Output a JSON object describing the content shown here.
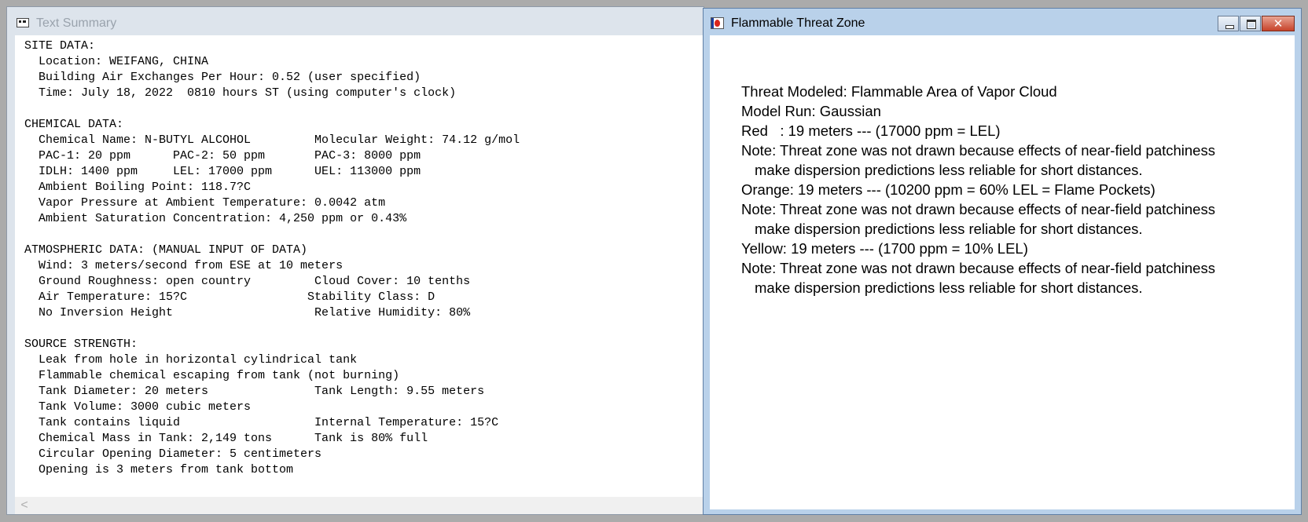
{
  "summary_window": {
    "title": "Text Summary",
    "lines": [
      "SITE DATA:",
      "  Location: WEIFANG, CHINA",
      "  Building Air Exchanges Per Hour: 0.52 (user specified)",
      "  Time: July 18, 2022  0810 hours ST (using computer's clock)",
      "",
      "CHEMICAL DATA:",
      "  Chemical Name: N-BUTYL ALCOHOL         Molecular Weight: 74.12 g/mol",
      "  PAC-1: 20 ppm      PAC-2: 50 ppm       PAC-3: 8000 ppm",
      "  IDLH: 1400 ppm     LEL: 17000 ppm      UEL: 113000 ppm",
      "  Ambient Boiling Point: 118.7?C",
      "  Vapor Pressure at Ambient Temperature: 0.0042 atm",
      "  Ambient Saturation Concentration: 4,250 ppm or 0.43%",
      "",
      "ATMOSPHERIC DATA: (MANUAL INPUT OF DATA)",
      "  Wind: 3 meters/second from ESE at 10 meters",
      "  Ground Roughness: open country         Cloud Cover: 10 tenths",
      "  Air Temperature: 15?C                 Stability Class: D",
      "  No Inversion Height                    Relative Humidity: 80%",
      "",
      "SOURCE STRENGTH:",
      "  Leak from hole in horizontal cylindrical tank",
      "  Flammable chemical escaping from tank (not burning)",
      "  Tank Diameter: 20 meters               Tank Length: 9.55 meters",
      "  Tank Volume: 3000 cubic meters",
      "  Tank contains liquid                   Internal Temperature: 15?C",
      "  Chemical Mass in Tank: 2,149 tons      Tank is 80% full",
      "  Circular Opening Diameter: 5 centimeters",
      "  Opening is 3 meters from tank bottom"
    ],
    "scroll_left_glyph": "<"
  },
  "threat_window": {
    "title": "Flammable Threat Zone",
    "buttons": {
      "minimize": "minimize",
      "maximize": "maximize",
      "close": "✕"
    },
    "lines": [
      {
        "text": "Threat Modeled: Flammable Area of Vapor Cloud",
        "indent": false
      },
      {
        "text": "Model Run: Gaussian",
        "indent": false
      },
      {
        "text": "Red   : 19 meters --- (17000 ppm = LEL)",
        "indent": false
      },
      {
        "text": "Note: Threat zone was not drawn because effects of near-field patchiness",
        "indent": false
      },
      {
        "text": "make dispersion predictions less reliable for short distances.",
        "indent": true
      },
      {
        "text": "Orange: 19 meters --- (10200 ppm = 60% LEL = Flame Pockets)",
        "indent": false
      },
      {
        "text": "Note: Threat zone was not drawn because effects of near-field patchiness",
        "indent": false
      },
      {
        "text": "make dispersion predictions less reliable for short distances.",
        "indent": true
      },
      {
        "text": "Yellow: 19 meters --- (1700 ppm = 10% LEL)",
        "indent": false
      },
      {
        "text": "Note: Threat zone was not drawn because effects of near-field patchiness",
        "indent": false
      },
      {
        "text": "make dispersion predictions less reliable for short distances.",
        "indent": true
      }
    ]
  },
  "colors": {
    "desktop": "#ababab",
    "inactive_frame": "#dde4ec",
    "active_frame": "#b9d1ea",
    "close_button": "#c7432a"
  }
}
